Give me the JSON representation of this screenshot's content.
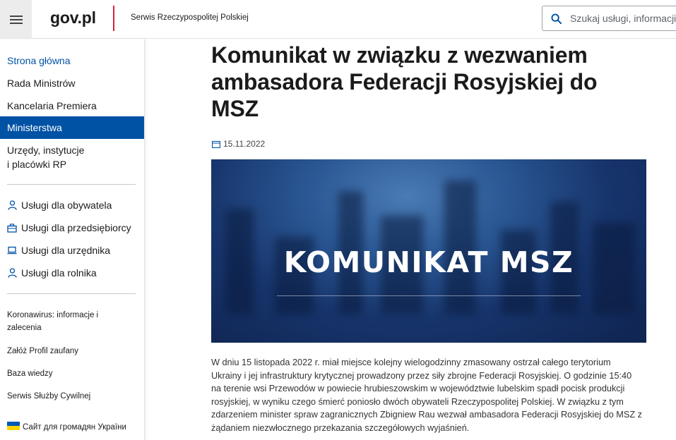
{
  "header": {
    "logo": "gov.pl",
    "subtitle": "Serwis Rzeczypospolitej Polskiej",
    "search_placeholder": "Szukaj usługi, informacji"
  },
  "sidebar": {
    "main_items": [
      {
        "label": "Strona główna",
        "state": "link"
      },
      {
        "label": "Rada Ministrów",
        "state": "normal"
      },
      {
        "label": "Kancelaria Premiera",
        "state": "normal"
      },
      {
        "label": "Ministerstwa",
        "state": "active"
      },
      {
        "label": "Urzędy, instytucje i placówki RP",
        "state": "normal"
      }
    ],
    "services": [
      {
        "label": "Usługi dla obywatela",
        "icon": "person-icon"
      },
      {
        "label": "Usługi dla przedsiębiorcy",
        "icon": "briefcase-icon"
      },
      {
        "label": "Usługi dla urzędnika",
        "icon": "laptop-icon"
      },
      {
        "label": "Usługi dla rolnika",
        "icon": "person-icon"
      }
    ],
    "links": [
      "Koronawirus: informacje i zalecenia",
      "Załóż Profil zaufany",
      "Baza wiedzy",
      "Serwis Służby Cywilnej",
      "Сайт для громадян України"
    ]
  },
  "article": {
    "title": "Komunikat w związku z wezwaniem ambasadora Federacji Rosyjskiej do MSZ",
    "date": "15.11.2022",
    "hero_label": "KOMUNIKAT MSZ",
    "lead": "W dniu 15 listopada 2022 r. miał miejsce kolejny wielogodzinny zmasowany ostrzał całego terytorium Ukrainy i jej infrastruktury krytycznej prowadzony przez siły zbrojne Federacji Rosyjskiej. O godzinie 15:40 na terenie wsi Przewodów w powiecie hrubieszowskim w województwie lubelskim spadł pocisk produkcji rosyjskiej, w wyniku czego śmierć poniosło dwóch obywateli Rzeczypospolitej Polskiej. W związku z tym zdarzeniem minister spraw zagranicznych Zbigniew Rau wezwał ambasadora Federacji Rosyjskiej do MSZ z żądaniem niezwłocznego przekazania szczegółowych wyjaśnień."
  },
  "colors": {
    "accent": "#0052a5",
    "logo_divider": "#d4213d"
  }
}
